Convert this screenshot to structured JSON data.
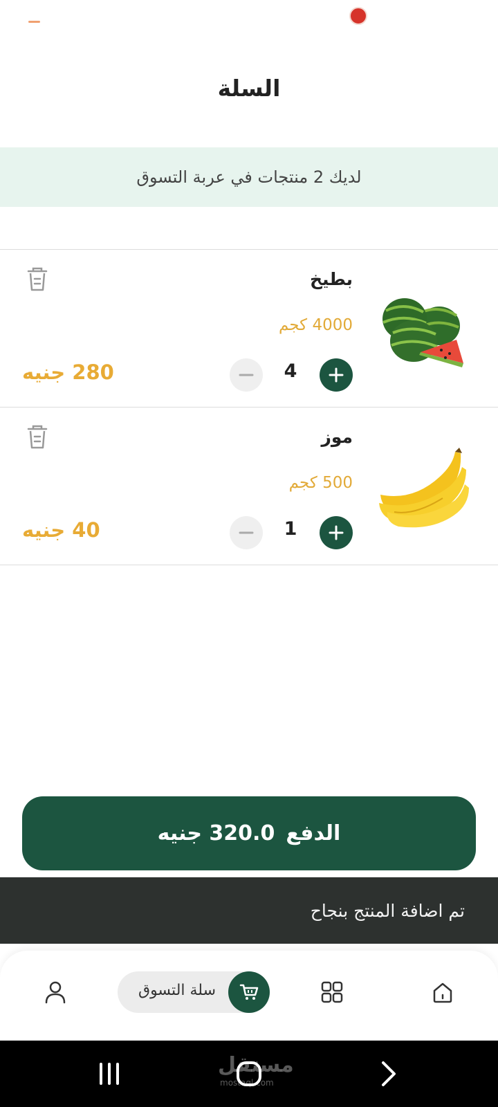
{
  "header": {
    "title": "السلة"
  },
  "banner": {
    "text": "لديك 2 منتجات في عربة التسوق"
  },
  "cart": {
    "items": [
      {
        "name": "بطيخ",
        "weight": "4000 كجم",
        "quantity": "4",
        "price": "280 جنيه",
        "image_icon": "watermelon-image"
      },
      {
        "name": "موز",
        "weight": "500 كجم",
        "quantity": "1",
        "price": "40 جنيه",
        "image_icon": "banana-image"
      }
    ]
  },
  "payment": {
    "label": "الدفع",
    "amount": "320.0 جنيه"
  },
  "toast": {
    "message": "تم اضافة المنتج بنجاح"
  },
  "bottom_nav": {
    "items": [
      {
        "icon": "home-icon"
      },
      {
        "icon": "grid-icon"
      },
      {
        "icon": "cart-icon",
        "label": "سلة التسوق",
        "active": true
      },
      {
        "icon": "user-icon"
      }
    ]
  },
  "watermark": {
    "text": "مستقل",
    "subtext": "mostaql.com"
  },
  "colors": {
    "primary_green": "#1c5540",
    "accent_gold": "#e8ab35",
    "banner_bg": "#e7f4ee",
    "toast_bg": "#2d312f"
  }
}
